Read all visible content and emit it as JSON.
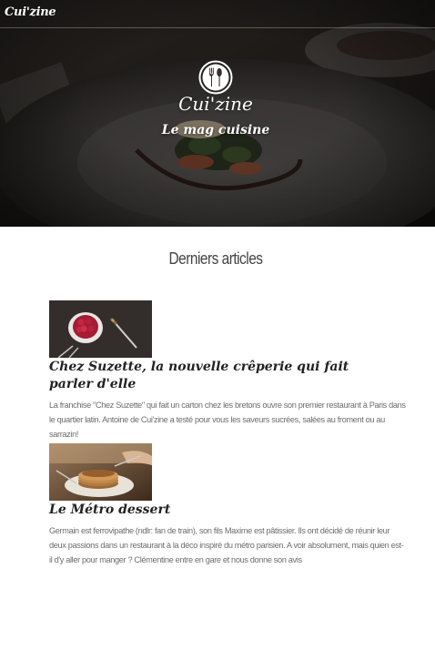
{
  "header": {
    "brand": "Cui'zine"
  },
  "hero": {
    "title": "Cui'zine",
    "subtitle": "Le mag cuisine",
    "logo_icon": "fork-spoon-icon"
  },
  "section": {
    "title": "Derniers articles"
  },
  "articles": [
    {
      "title": "Chez Suzette, la nouvelle crêperie qui fait parler d'elle",
      "excerpt": "La franchise \"Chez Suzette\" qui fait un carton chez les bretons ouvre son premier restaurant à Paris dans le quartier latin. Antoine de Cui'zine a testé pour vous les saveurs sucrées, salées au froment ou au sarrazin!"
    },
    {
      "title": "Le Métro dessert",
      "excerpt": "Germain est ferrovipathe (ndlr: fan de train), son fils Maxime est pâtissier. Ils ont décidé de réunir leur deux passions dans un restaurant à la déco inspiré du métro parisien. A voir absolument, mais quien est-il d'y aller pour manger ? Clémentine entre en gare et nous donne son avis"
    }
  ],
  "colors": {
    "hero_overlay": "#2a2623",
    "text_dark": "#222222",
    "text_muted": "#6d6d6d",
    "heading": "#444444"
  }
}
